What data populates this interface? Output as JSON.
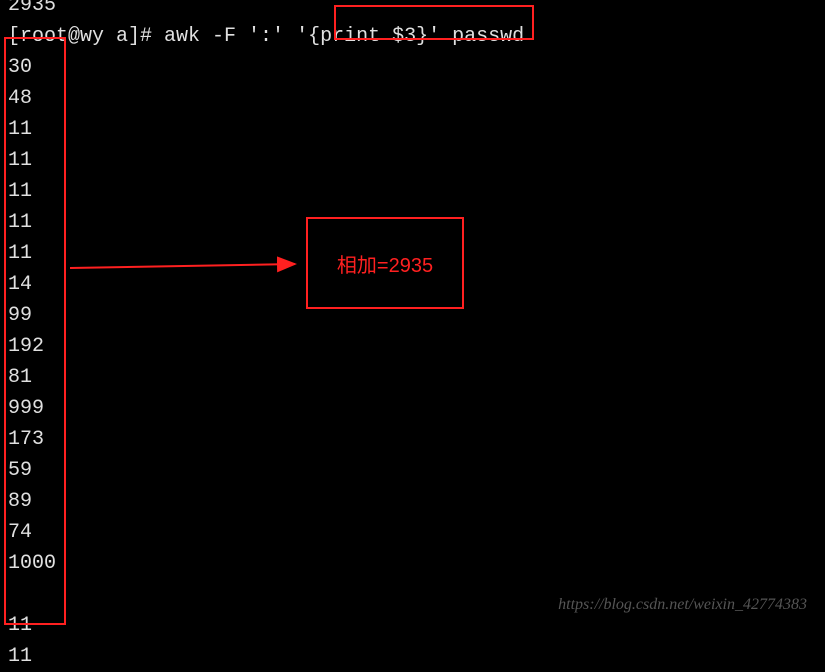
{
  "terminal": {
    "top_cut": "2935",
    "prompt": "[root@wy a]# ",
    "command_pre": "awk -F ':' ",
    "command_highlight": "'{print $3}'",
    "command_post": " passwd",
    "output": [
      "30",
      "48",
      "11",
      "11",
      "11",
      "11",
      "11",
      "14",
      "99",
      "192",
      "81",
      "999",
      "173",
      "59",
      "89",
      "74",
      "1000",
      "",
      "11",
      "11"
    ]
  },
  "annotation": {
    "label": "相加=2935"
  },
  "watermark": "https://blog.csdn.net/weixin_42774383"
}
